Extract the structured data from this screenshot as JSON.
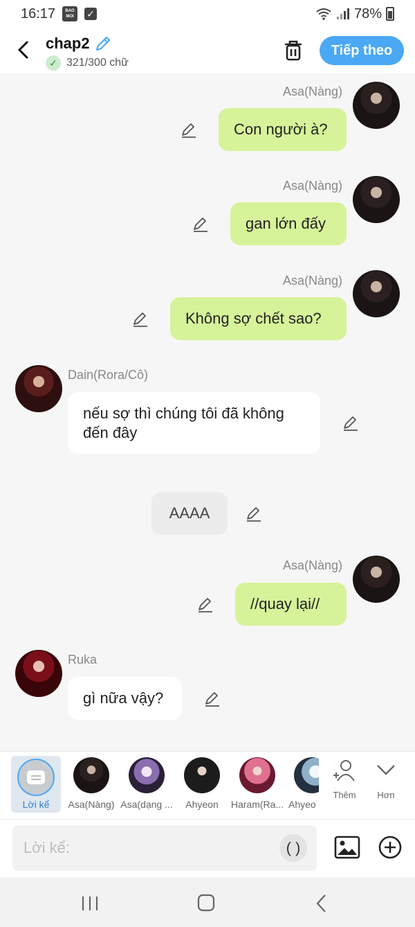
{
  "status_bar": {
    "time": "16:17",
    "app_badge": "BAO MOI",
    "battery": "78%"
  },
  "header": {
    "title": "chap2",
    "word_count": "321/300 chữ",
    "next_label": "Tiếp theo"
  },
  "messages": [
    {
      "speaker": "Asa(Nàng)",
      "text": "Con người à?",
      "side": "right"
    },
    {
      "speaker": "Asa(Nàng)",
      "text": "gan lớn đấy",
      "side": "right"
    },
    {
      "speaker": "Asa(Nàng)",
      "text": "Không sợ chết sao?",
      "side": "right"
    },
    {
      "speaker": "Dain(Rora/Cô)",
      "text_line1": "nếu sợ thì chúng tôi đã không",
      "text_line2": "đến đây",
      "side": "left"
    },
    {
      "speaker": "",
      "text": "AAAA",
      "side": "center"
    },
    {
      "speaker": "Asa(Nàng)",
      "text": "//quay lại//",
      "side": "right"
    },
    {
      "speaker": "Ruka",
      "text": "gì nữa vậy?",
      "side": "left"
    }
  ],
  "characters": {
    "narration": "Lời kể",
    "list": [
      "Asa(Nàng)",
      "Asa(dạng ...",
      "Ahyeon",
      "Haram(Ra...",
      "Ahyeo"
    ],
    "more_label": "Thêm",
    "expand_label": "Hơn"
  },
  "input": {
    "placeholder": "Lời kể:",
    "paren": "( )"
  },
  "colors": {
    "accent": "#4aa8f5",
    "bubble_right": "#d6f39a",
    "bubble_left": "#ffffff"
  }
}
